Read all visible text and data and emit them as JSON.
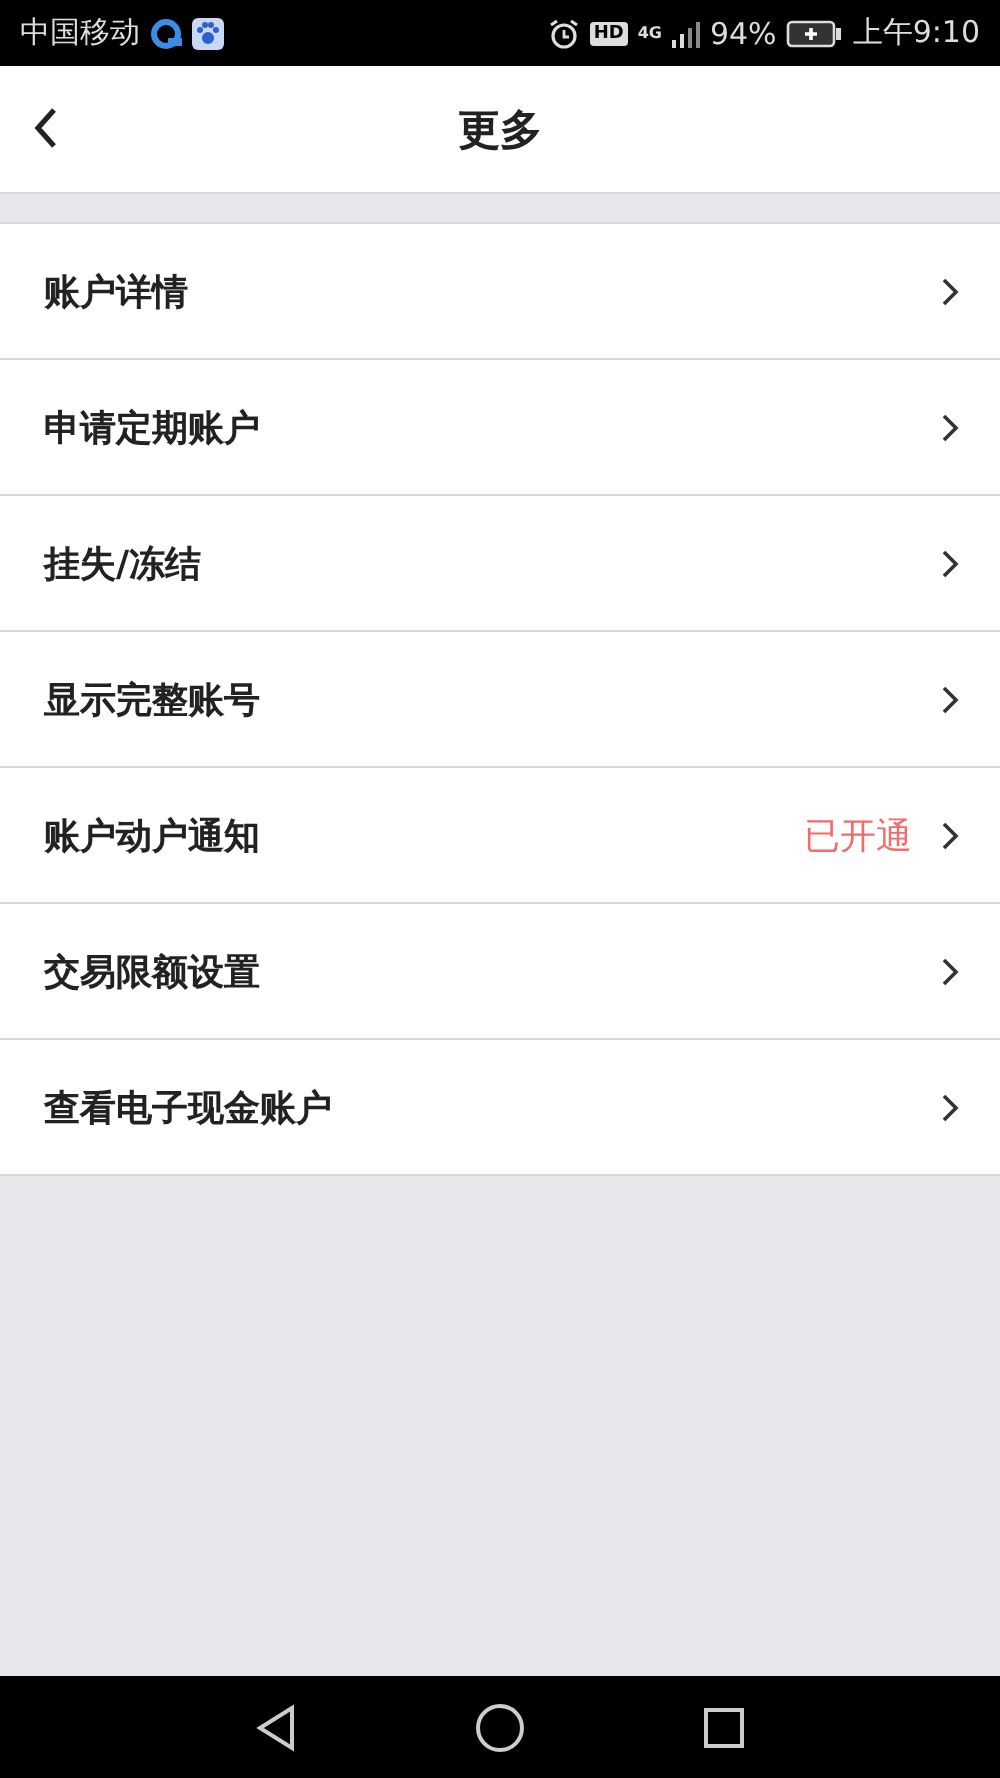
{
  "status_bar": {
    "carrier": "中国移动",
    "hd": "HD",
    "network": "4G",
    "battery": "94%",
    "time": "上午9:10"
  },
  "header": {
    "title": "更多"
  },
  "menu": [
    {
      "label": "账户详情"
    },
    {
      "label": "申请定期账户"
    },
    {
      "label": "挂失/冻结"
    },
    {
      "label": "显示完整账号"
    },
    {
      "label": "账户动户通知",
      "value": "已开通"
    },
    {
      "label": "交易限额设置"
    },
    {
      "label": "查看电子现金账户"
    }
  ]
}
